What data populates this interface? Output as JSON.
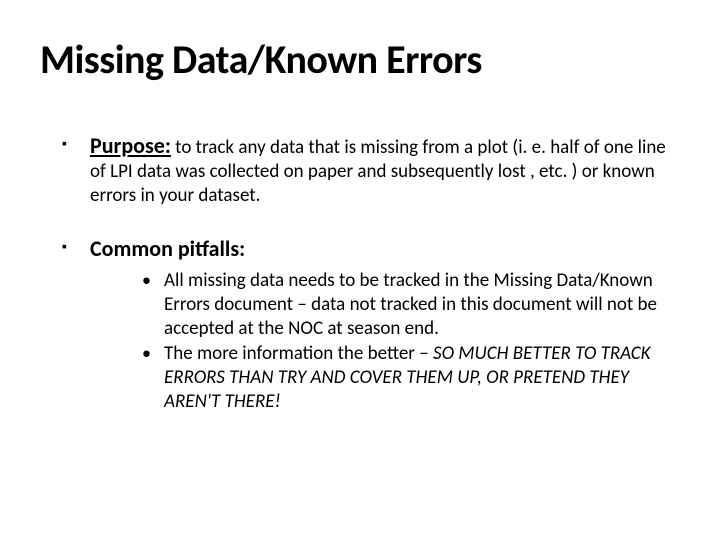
{
  "title": "Missing Data/Known Errors",
  "items": [
    {
      "lead": "Purpose:",
      "underline": true,
      "tail": " to track any data that is missing from a plot (i. e. half of one line of LPI data was collected on paper and subsequently lost , etc. ) or known errors in your dataset."
    },
    {
      "lead": "Common pitfalls:",
      "underline": false,
      "subs": [
        {
          "text": "All missing data needs to be tracked in the Missing Data/Known Errors document – data not tracked in this document will not be accepted at the NOC at season end."
        },
        {
          "pre": "The more information the better –  ",
          "emph": "SO MUCH BETTER TO TRACK ERRORS THAN TRY AND COVER THEM UP, OR PRETEND THEY AREN'T THERE!"
        }
      ]
    }
  ]
}
